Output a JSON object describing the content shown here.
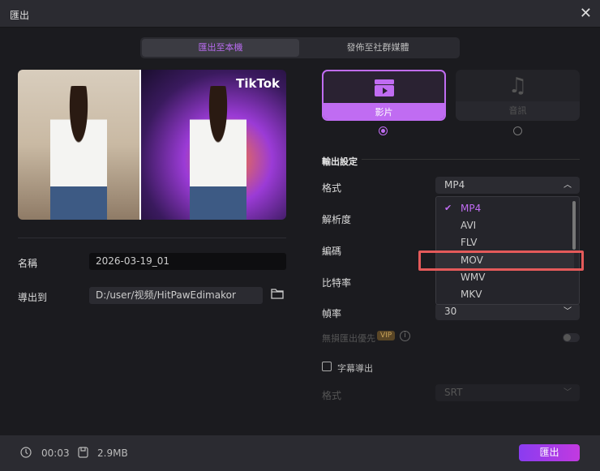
{
  "window": {
    "title": "匯出",
    "close_icon": "close-icon"
  },
  "tabs": [
    {
      "label": "匯出至本機",
      "active": true
    },
    {
      "label": "發佈至社群媒體",
      "active": false
    }
  ],
  "preview": {
    "watermark": "TikTok"
  },
  "left": {
    "name_label": "名稱",
    "name_value": "2026-03-19_01",
    "export_to_label": "導出到",
    "export_path": "D:/user/视频/HitPawEdimakor"
  },
  "types": [
    {
      "label": "影片",
      "icon": "video-clapper-icon",
      "selected": true
    },
    {
      "label": "音訊",
      "icon": "music-note-icon",
      "selected": false
    }
  ],
  "settings": {
    "section_title": "輸出設定",
    "format_label": "格式",
    "format_value": "MP4",
    "resolution_label": "解析度",
    "codec_label": "編碼",
    "bitrate_label": "比特率",
    "framerate_label": "幀率",
    "framerate_value": "30",
    "lossless_label": "無損匯出優先",
    "vip_badge": "VIP",
    "lossless_enabled": false,
    "subtitle_label": "字幕導出",
    "subtitle_checked": false,
    "subtitle_format_label": "格式",
    "subtitle_format_value": "SRT"
  },
  "format_options": [
    "MP4",
    "AVI",
    "FLV",
    "MOV",
    "WMV",
    "MKV"
  ],
  "format_selected": "MP4",
  "highlighted_option": "MOV",
  "footer": {
    "duration": "00:03",
    "size": "2.9MB",
    "export_button": "匯出"
  },
  "colors": {
    "accent": "#c06cf2",
    "highlight": "#e45a5a"
  }
}
